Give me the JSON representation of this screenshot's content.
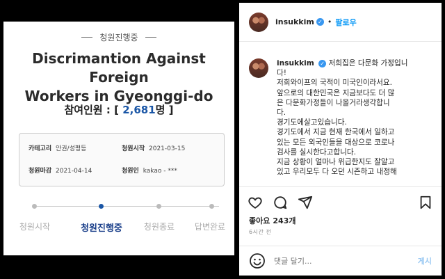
{
  "petition": {
    "status": "청원진행중",
    "title_line1": "Discrimantion Against Foreign",
    "title_line2": "Workers in Gyeonggi-do",
    "participants_label": "참여인원 : [",
    "participants_count": "2,681",
    "participants_suffix": "명 ]",
    "info": {
      "category_label": "카테고리",
      "category_value": "안권/성평등",
      "start_label": "청원시작",
      "start_value": "2021-03-15",
      "end_label": "청원마감",
      "end_value": "2021-04-14",
      "petitioner_label": "청원인",
      "petitioner_value": "kakao - ***"
    },
    "steps": [
      {
        "label": "청원시작"
      },
      {
        "label": "청원진행중"
      },
      {
        "label": "청원종료"
      },
      {
        "label": "답변완료"
      }
    ],
    "active_step": 1
  },
  "instagram": {
    "username": "insukkim",
    "follow_label": "팔로우",
    "separator": "•",
    "verified_glyph": "✓",
    "caption_username": "insukkim",
    "caption_first": "저희집은 다문화 가정입니",
    "caption_lines": [
      "다!",
      "저희와이프의 국적이 미국인이라서요.",
      "앞으로의 대한민국은 지금보다도 더 많",
      "은 다문화가정들이 나올거라생각합니",
      "다.",
      "경기도에살고있습니다.",
      "경기도에서 지금 현재 한국에서 일하고",
      "있는 모든 외국인들을 대상으로 코로나",
      "검사를 실시한다고합니다.",
      "지금 상황이 얼마나 위급한지도 잘알고",
      "있고 우리모두 다 오던 시즌하고 내정해"
    ],
    "likes_label": "좋아요",
    "likes_count": "243개",
    "time_ago": "6시간 전",
    "comment_placeholder": "댓글 달기...",
    "post_label": "게시",
    "icons": [
      "heart-icon",
      "comment-icon",
      "share-icon",
      "bookmark-icon",
      "smiley-icon"
    ]
  },
  "colors": {
    "accent_blue": "#1a56a6",
    "instagram_blue": "#0095f6"
  }
}
